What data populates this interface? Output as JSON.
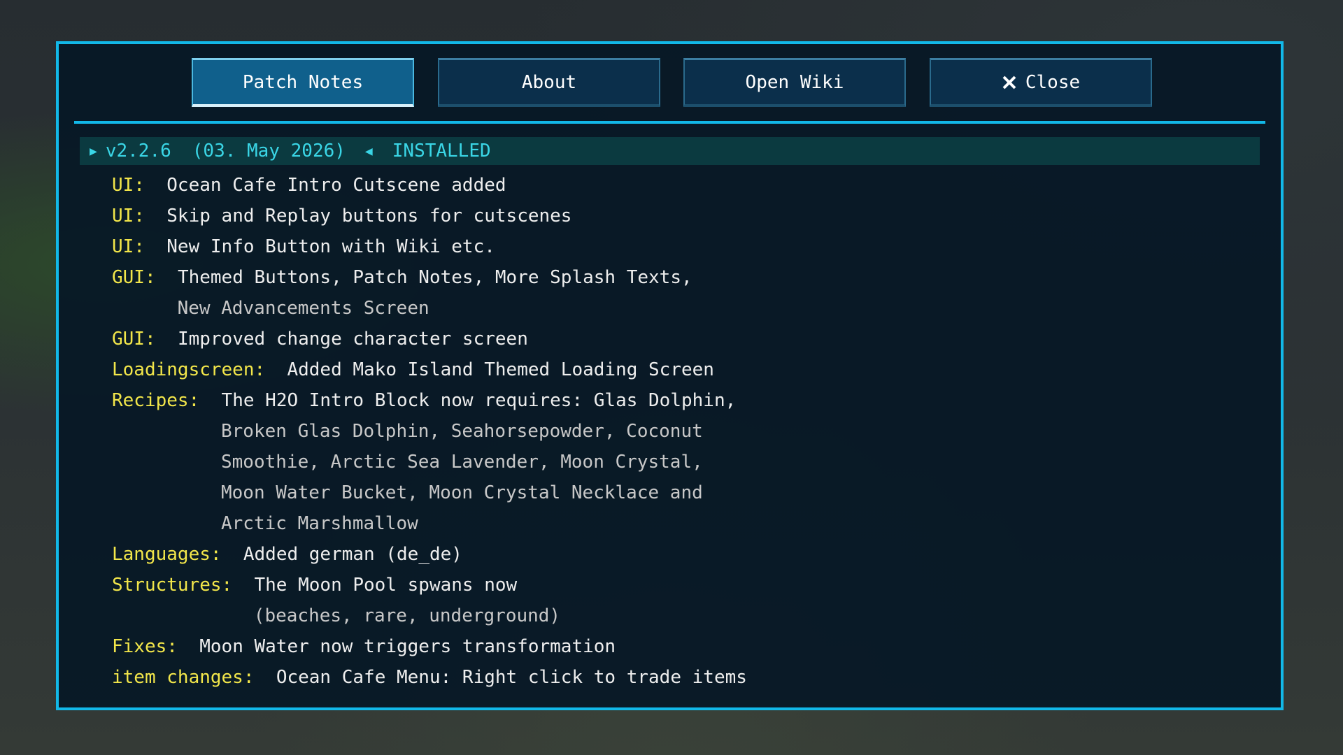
{
  "tabs": [
    {
      "label": "Patch Notes",
      "active": true
    },
    {
      "label": "About",
      "active": false
    },
    {
      "label": "Open Wiki",
      "active": false
    },
    {
      "label": "Close",
      "icon": "close-icon",
      "active": false
    }
  ],
  "version": {
    "marker_left": "▶",
    "number": "v2.2.6",
    "date": "(03. May 2026)",
    "marker_right": "◀",
    "status": "INSTALLED"
  },
  "notes": [
    {
      "category": "UI:",
      "text": "Ocean Cafe Intro Cutscene added",
      "continuation": []
    },
    {
      "category": "UI:",
      "text": "Skip and Replay buttons for cutscenes",
      "continuation": []
    },
    {
      "category": "UI:",
      "text": "New Info Button with Wiki etc.",
      "continuation": []
    },
    {
      "category": "GUI:",
      "text": "Themed Buttons, Patch Notes, More Splash Texts,",
      "continuation": [
        "New Advancements Screen"
      ]
    },
    {
      "category": "GUI:",
      "text": "Improved change character screen",
      "continuation": []
    },
    {
      "category": "Loadingscreen:",
      "text": "Added Mako Island Themed Loading Screen",
      "continuation": []
    },
    {
      "category": "Recipes:",
      "text": "The H2O Intro Block now requires: Glas Dolphin,",
      "continuation": [
        "Broken Glas Dolphin, Seahorsepowder, Coconut",
        "Smoothie, Arctic Sea Lavender, Moon Crystal,",
        "Moon Water Bucket, Moon Crystal Necklace and",
        "Arctic Marshmallow"
      ]
    },
    {
      "category": "Languages:",
      "text": "Added german (de_de)",
      "continuation": []
    },
    {
      "category": "Structures:",
      "text": "The Moon Pool spwans now",
      "continuation": [
        "(beaches, rare, underground)"
      ]
    },
    {
      "category": "Fixes:",
      "text": "Moon Water now triggers transformation",
      "continuation": []
    },
    {
      "category": "item changes:",
      "text": "Ocean Cafe Menu: Right click to trade items",
      "continuation": []
    }
  ],
  "colors": {
    "accent": "#12b8e8",
    "category": "#f2e64a",
    "version": "#3ad6e6"
  }
}
